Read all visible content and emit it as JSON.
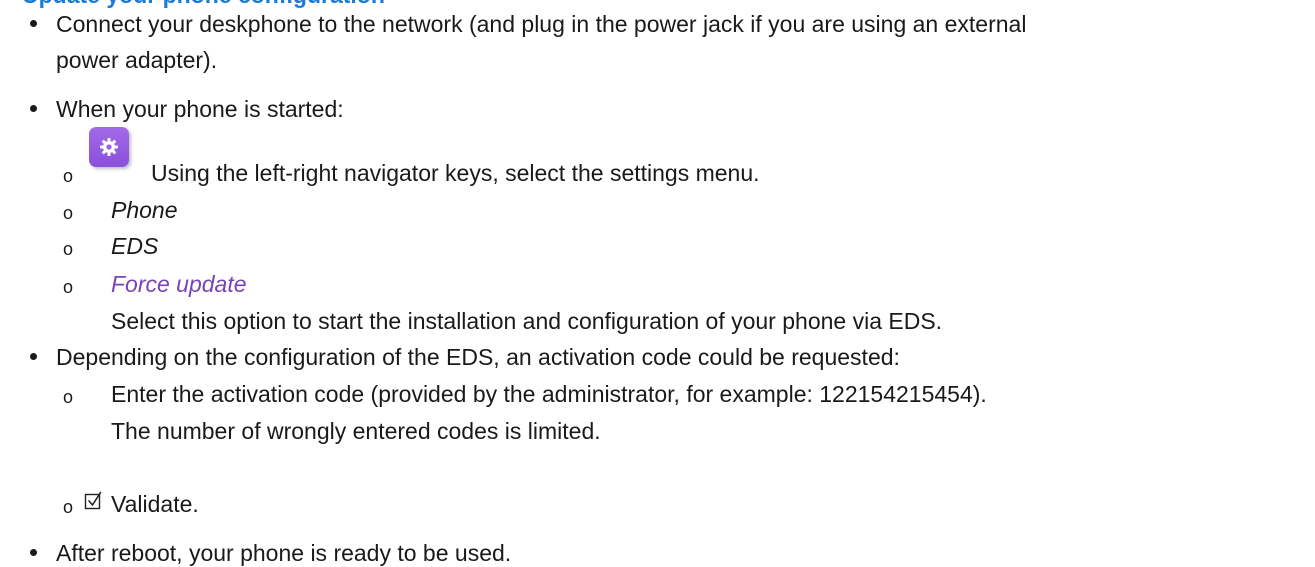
{
  "heading": "Update your phone configuration",
  "bullets": {
    "b1_line1": " Connect your deskphone to the network (and plug in the power jack if you are using an external",
    "b1_line2": "power adapter).",
    "b2": "When your phone is started:",
    "b2_sub1": "Using the left-right navigator keys, select the settings menu.",
    "b2_sub2": "Phone",
    "b2_sub3": "EDS",
    "b2_sub4": "Force update",
    "b2_sub4_desc": "Select this option to start the installation and configuration of your phone via EDS.",
    "b3": "Depending on the configuration of the EDS, an activation code could be requested:",
    "b3_sub1_line1": "Enter the activation code (provided by the administrator, for example: 122154215454).",
    "b3_sub1_line2": "The number of wrongly entered codes is limited.",
    "b3_sub2": "Validate.",
    "b4": "After reboot, your phone is ready to be used."
  },
  "sub_bullet_marker": "o",
  "icons": {
    "settings": "gear-icon",
    "validate": "checkbox-check-icon"
  },
  "colors": {
    "heading": "#1b7bd6",
    "highlight": "#7a43b6",
    "settings_icon_bg": "#9a5fe4"
  }
}
